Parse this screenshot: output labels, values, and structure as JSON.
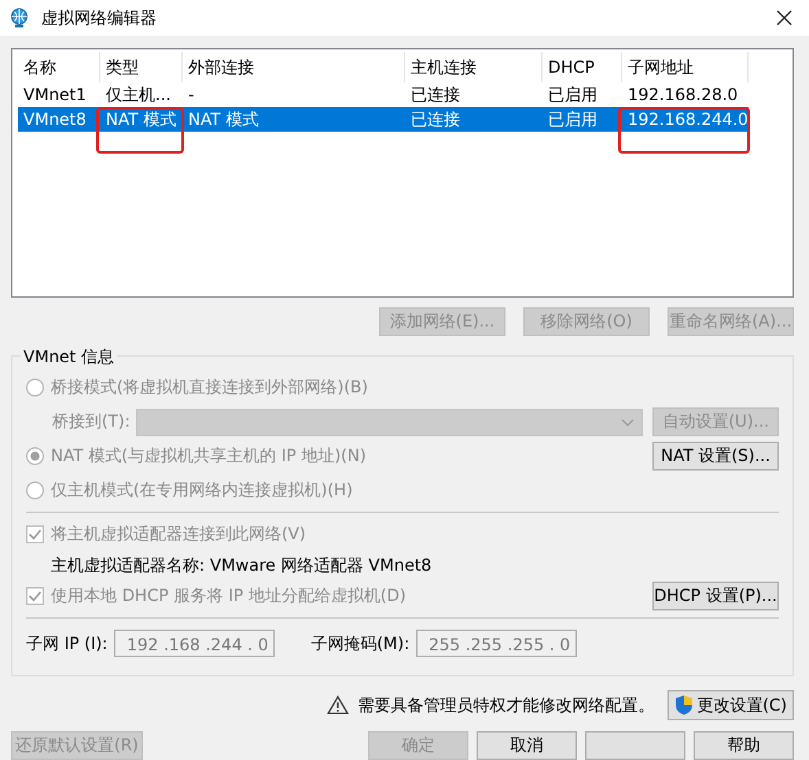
{
  "window": {
    "title": "虚拟网络编辑器"
  },
  "network_list": {
    "columns": [
      "名称",
      "类型",
      "外部连接",
      "主机连接",
      "DHCP",
      "子网地址"
    ],
    "rows": [
      {
        "selected": false,
        "cells": [
          {
            "text": "VMnet1",
            "circled": false
          },
          {
            "text": "仅主机...",
            "circled": false
          },
          {
            "text": "-",
            "circled": false
          },
          {
            "text": "已连接",
            "circled": false
          },
          {
            "text": "已启用",
            "circled": false
          },
          {
            "text": "192.168.28.0",
            "circled": false
          }
        ]
      },
      {
        "selected": true,
        "cells": [
          {
            "text": "VMnet8",
            "circled": false
          },
          {
            "text": "NAT 模式",
            "circled": true
          },
          {
            "text": "NAT 模式",
            "circled": false
          },
          {
            "text": "已连接",
            "circled": false
          },
          {
            "text": "已启用",
            "circled": false
          },
          {
            "text": "192.168.244.0",
            "circled": true
          }
        ]
      }
    ]
  },
  "list_buttons": [
    {
      "label": "添加网络(E)...",
      "disabled": true
    },
    {
      "label": "移除网络(O)",
      "disabled": true
    },
    {
      "label": "重命名网络(A)...",
      "disabled": true
    }
  ],
  "vmnet_info": {
    "legend": "VMnet 信息",
    "bridged": {
      "label": "桥接模式(将虚拟机直接连接到外部网络)(B)",
      "selected": false,
      "disabled": true
    },
    "bridge_to": {
      "label": "桥接到(T):",
      "disabled": true
    },
    "auto_button": {
      "label": "自动设置(U)...",
      "disabled": true
    },
    "nat": {
      "label": "NAT 模式(与虚拟机共享主机的 IP 地址)(N)",
      "selected": true,
      "disabled": true
    },
    "nat_button": {
      "label": "NAT 设置(S)...",
      "disabled": false
    },
    "host_only": {
      "label": "仅主机模式(在专用网络内连接虚拟机)(H)",
      "selected": false,
      "disabled": true
    },
    "connect_adapter": {
      "label": "将主机虚拟适配器连接到此网络(V)",
      "checked": true,
      "disabled": true
    },
    "adapter_name": "主机虚拟适配器名称: VMware 网络适配器 VMnet8",
    "dhcp": {
      "label": "使用本地 DHCP 服务将 IP 地址分配给虚拟机(D)",
      "checked": true,
      "disabled": true
    },
    "dhcp_button": {
      "label": "DHCP 设置(P)...",
      "disabled": false
    },
    "subnet_ip": {
      "label": "子网 IP (I):",
      "value": "192 .168 .244 . 0"
    },
    "subnet_mask": {
      "label": "子网掩码(M):",
      "value": "255 .255 .255 . 0"
    }
  },
  "admin_notice": "需要具备管理员特权才能修改网络配置。",
  "change_button": {
    "label": "更改设置(C)",
    "disabled": false
  },
  "reset_button": {
    "label": "还原默认设置(R)",
    "disabled": true
  },
  "footer_buttons": [
    {
      "label": "确定",
      "disabled": true
    },
    {
      "label": "取消",
      "disabled": false
    },
    {
      "disabled": false
    },
    {
      "label": "帮助",
      "disabled": false
    }
  ]
}
